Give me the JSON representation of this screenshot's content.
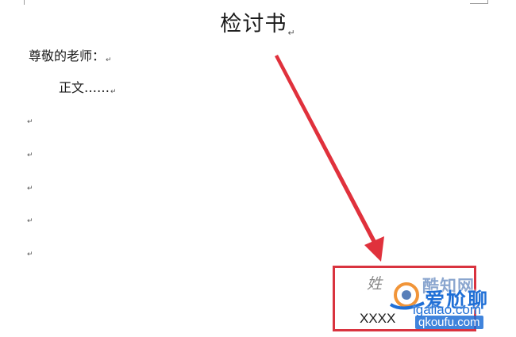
{
  "document": {
    "title": "检讨书",
    "salutation": "尊敬的老师：",
    "body": "正文……",
    "paragraph_mark": "↵",
    "empty_paragraph_count": 5
  },
  "annotation": {
    "arrow_color": "#e0313c",
    "box_color": "#d9333f",
    "signature_name": "姓",
    "signature_date": "XXXX"
  },
  "watermarks": {
    "site_1": "酷知网",
    "site_2": "爱尬聊",
    "url_1": "igaliao.com",
    "url_2": "qkoufu.com"
  }
}
